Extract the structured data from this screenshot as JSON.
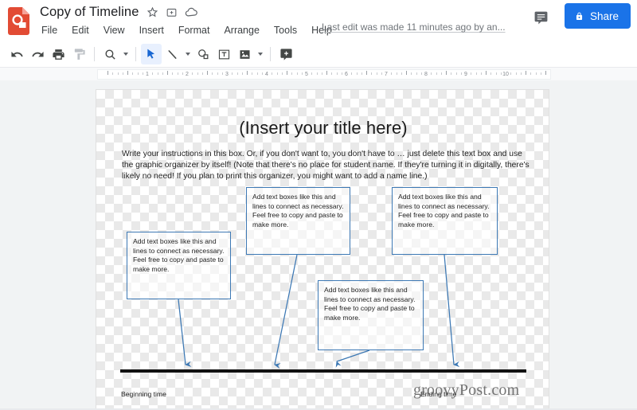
{
  "header": {
    "logo_icon": "google-slides-logo",
    "doc_title": "Copy of Timeline",
    "star_icon": "star-icon",
    "move_icon": "move-to-folder-icon",
    "cloud_icon": "cloud-saved-icon",
    "last_edit": "Last edit was made 11 minutes ago by an...",
    "comment_icon": "comment-icon",
    "share_label": "Share",
    "share_lock_icon": "lock-icon",
    "share_color": "#1a73e8",
    "menu": [
      {
        "label": "File",
        "name": "menu-file"
      },
      {
        "label": "Edit",
        "name": "menu-edit"
      },
      {
        "label": "View",
        "name": "menu-view"
      },
      {
        "label": "Insert",
        "name": "menu-insert"
      },
      {
        "label": "Format",
        "name": "menu-format"
      },
      {
        "label": "Arrange",
        "name": "menu-arrange"
      },
      {
        "label": "Tools",
        "name": "menu-tools"
      },
      {
        "label": "Help",
        "name": "menu-help"
      }
    ]
  },
  "toolbar": {
    "items": [
      "undo-icon",
      "redo-icon",
      "print-icon",
      "paint-format-icon",
      "zoom-icon",
      "select-icon",
      "line-icon",
      "shape-icon",
      "text-box-icon",
      "image-icon",
      "comment-add-icon"
    ],
    "active_tool": "select-icon"
  },
  "ruler": {
    "numbers": [
      1,
      2,
      3,
      4,
      5,
      6,
      7,
      8,
      9,
      10
    ],
    "unit": "inches"
  },
  "canvas": {
    "slide_title": "(Insert your title here)",
    "instructions": "Write your instructions in this box. Or, if you don't want to, you don't have to … just delete this text box and use the graphic organizer by itself! (Note that there's no place for student name. If they're turning it in digitally, there's likely no need! If you plan to print this organizer, you might want to add a name line.)",
    "text_boxes": [
      {
        "name": "text-box-top-left",
        "text": "Add text boxes like this and lines to connect as necessary. Feel free to copy and paste to make more."
      },
      {
        "name": "text-box-top-right",
        "text": "Add text boxes like this and lines to connect as necessary. Feel free to copy and paste to make more."
      },
      {
        "name": "text-box-left",
        "text": "Add text boxes like this and lines to connect as necessary. Feel free to copy and paste to make more."
      },
      {
        "name": "text-box-bottom-center",
        "text": "Add text boxes like this and lines to connect as necessary. Feel free to copy and paste to make more."
      }
    ],
    "timeline": {
      "begin_label": "Beginning time",
      "end_label": "Ending time",
      "bar_color": "#111111"
    },
    "connector_color": "#3c78b4",
    "watermark": "groovyPost.com"
  }
}
